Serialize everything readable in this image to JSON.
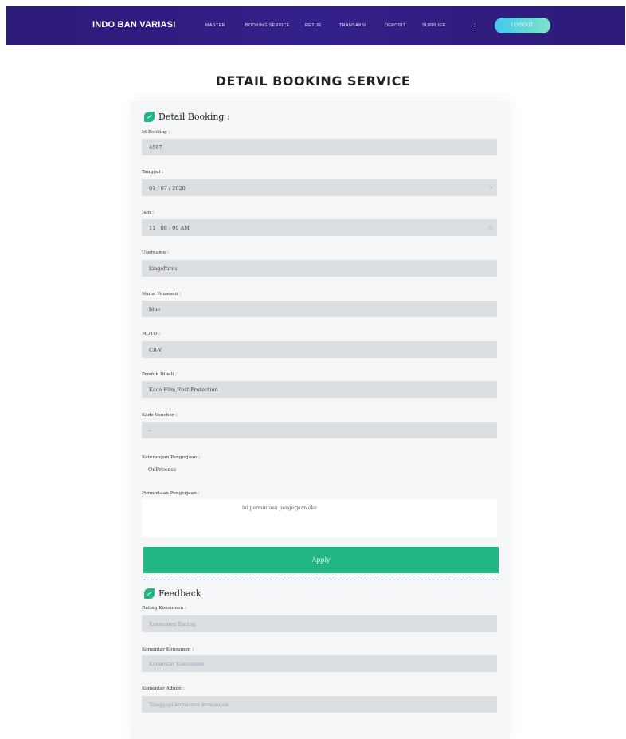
{
  "brand": "INDO BAN VARIASI",
  "nav": {
    "items": [
      "MASTER",
      "BOOKING SERVICE",
      "RETUR",
      "TRANSAKSI",
      "DEPOSIT",
      "SUPPLIER"
    ],
    "more": "⋮",
    "logout": "LOGOUT"
  },
  "page_title": "DETAIL BOOKING SERVICE",
  "detail": {
    "heading": "Detail Booking :",
    "fields": [
      {
        "label": "Id Booking :",
        "value": "4567"
      },
      {
        "label": "Tanggal :",
        "value": "01 / 07 / 2020"
      },
      {
        "label": "Jam :",
        "value": "11 : 08 : 00   AM"
      },
      {
        "label": "Username :",
        "value": "kingoftires"
      },
      {
        "label": "Nama Pemesan :",
        "value": "blue"
      },
      {
        "label": "MOTO :",
        "value": "CR-V"
      },
      {
        "label": "Produk Dibeli :",
        "value": "Kaca Film,Rust Protection"
      },
      {
        "label": "Kode Voucher :",
        "value": "-"
      }
    ],
    "status_label": "Keterangan Pengerjaan :",
    "status_value": "OnProcess",
    "request_label": "Permintaan Pengerjaan :",
    "request_value": "ini permintaan pengerjaan oke",
    "apply": "Apply"
  },
  "feedback": {
    "heading": "Feedback",
    "fields": [
      {
        "label": "Rating Konsumen :",
        "placeholder": "Konsumen Rating"
      },
      {
        "label": "Komentar Konsumen :",
        "placeholder": "Komentar Konsumen"
      },
      {
        "label": "Komentar Admin :",
        "placeholder": "Tanggapi komentar konsumen"
      }
    ]
  },
  "colors": {
    "navbar": "#2e1a78",
    "accent_green": "#22b585",
    "logout_gradient": [
      "#42c7ee",
      "#7fe3c8"
    ],
    "field_bg": "#dcdfe2"
  },
  "icons": {
    "section_icon": "leaf-icon",
    "nav_more": "more-vertical-icon"
  }
}
